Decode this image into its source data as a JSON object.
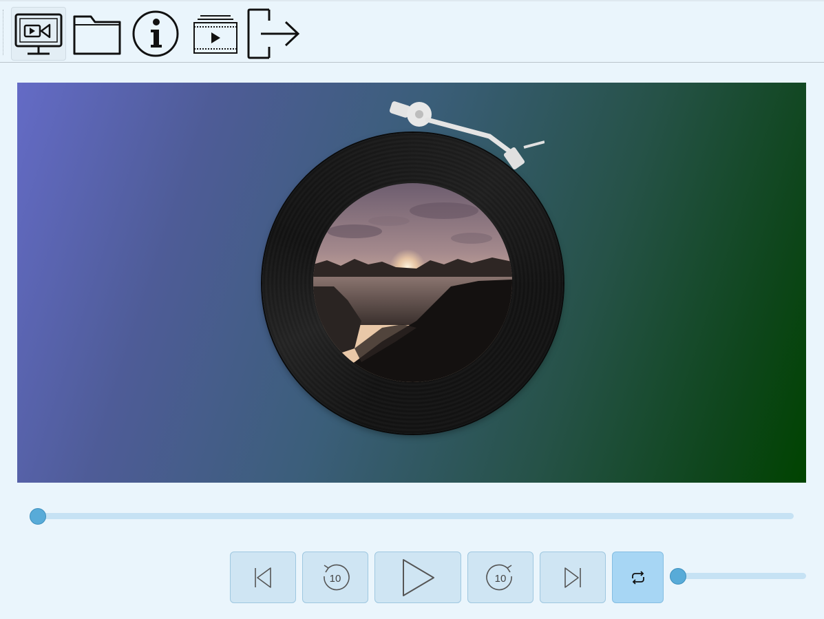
{
  "toolbar": {
    "buttons": [
      {
        "name": "monitor-video-icon",
        "active": true
      },
      {
        "name": "folder-icon",
        "active": false
      },
      {
        "name": "info-icon",
        "active": false
      },
      {
        "name": "playlist-icon",
        "active": false
      },
      {
        "name": "exit-icon",
        "active": false
      }
    ]
  },
  "player": {
    "artwork": "vinyl-record-with-sunset-lake-cover",
    "seek_progress": 0,
    "volume_level": 0,
    "repeat_enabled": true
  },
  "controls": {
    "skip_back_seconds": "10",
    "skip_forward_seconds": "10",
    "icons": [
      "previous-track-icon",
      "rewind-10-icon",
      "play-icon",
      "forward-10-icon",
      "next-track-icon",
      "repeat-icon"
    ]
  },
  "colors": {
    "background": "#eaf5fc",
    "accent": "#58abd8",
    "track": "#c6e2f4",
    "button": "#cfe5f3",
    "button_active": "#a7d6f4"
  }
}
